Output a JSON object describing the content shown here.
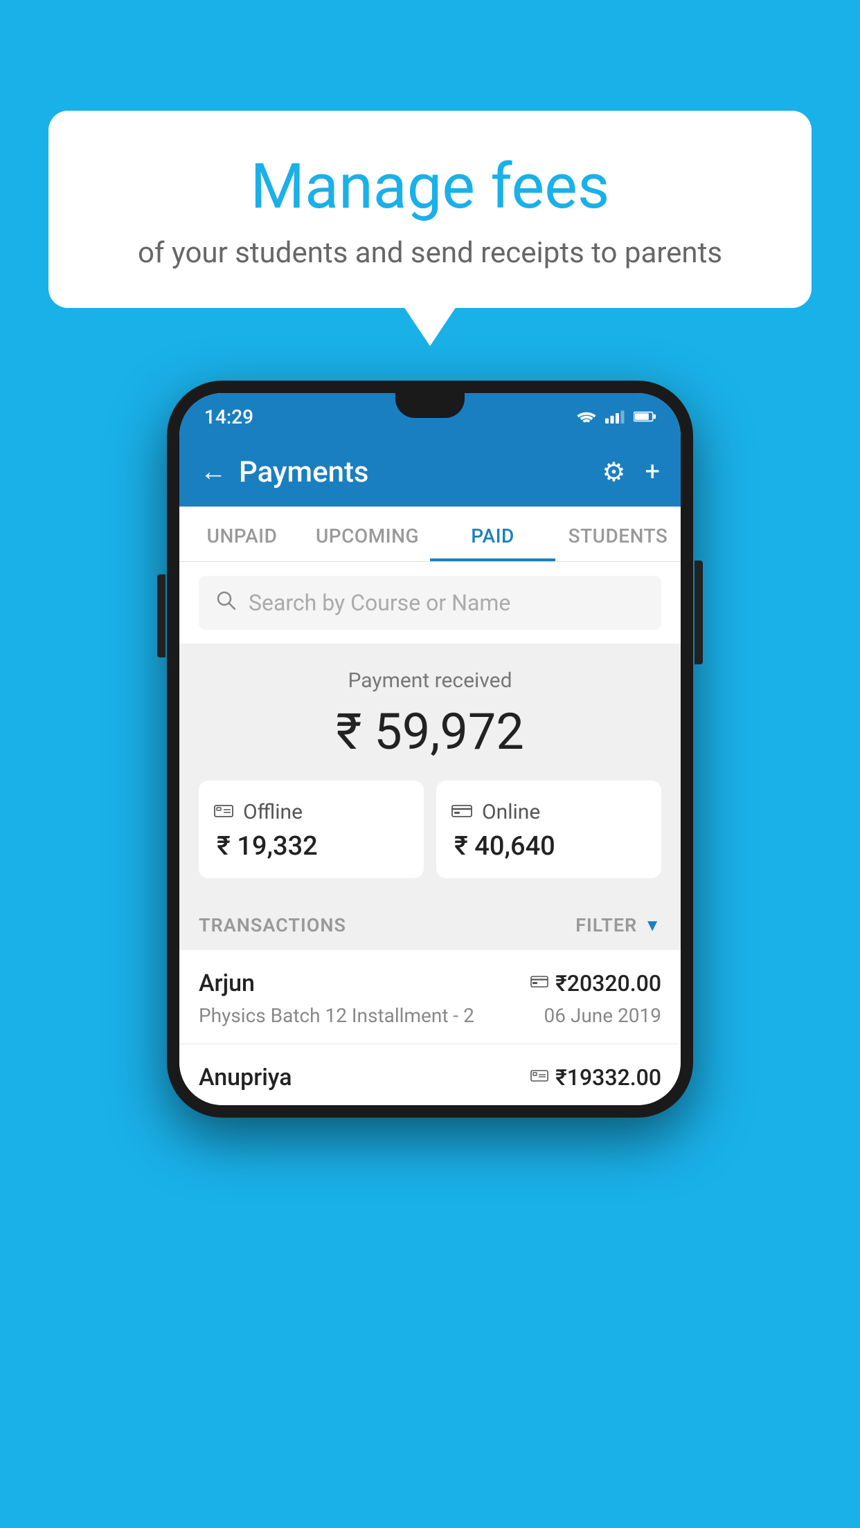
{
  "background_color": "#1ab0e8",
  "speech_bubble": {
    "title": "Manage fees",
    "subtitle": "of your students and send receipts to parents"
  },
  "status_bar": {
    "time": "14:29"
  },
  "header": {
    "title": "Payments",
    "back_label": "←",
    "gear_label": "⚙",
    "plus_label": "+"
  },
  "tabs": [
    {
      "id": "unpaid",
      "label": "UNPAID",
      "active": false
    },
    {
      "id": "upcoming",
      "label": "UPCOMING",
      "active": false
    },
    {
      "id": "paid",
      "label": "PAID",
      "active": true
    },
    {
      "id": "students",
      "label": "STUDENTS",
      "active": false
    }
  ],
  "search": {
    "placeholder": "Search by Course or Name"
  },
  "payment_summary": {
    "received_label": "Payment received",
    "total_amount": "₹ 59,972",
    "offline": {
      "label": "Offline",
      "amount": "₹ 19,332"
    },
    "online": {
      "label": "Online",
      "amount": "₹ 40,640"
    }
  },
  "transactions": {
    "section_label": "TRANSACTIONS",
    "filter_label": "FILTER",
    "items": [
      {
        "name": "Arjun",
        "course": "Physics Batch 12 Installment - 2",
        "amount": "₹20320.00",
        "date": "06 June 2019",
        "payment_type": "card"
      },
      {
        "name": "Anupriya",
        "course": "",
        "amount": "₹19332.00",
        "date": "",
        "payment_type": "cash"
      }
    ]
  }
}
